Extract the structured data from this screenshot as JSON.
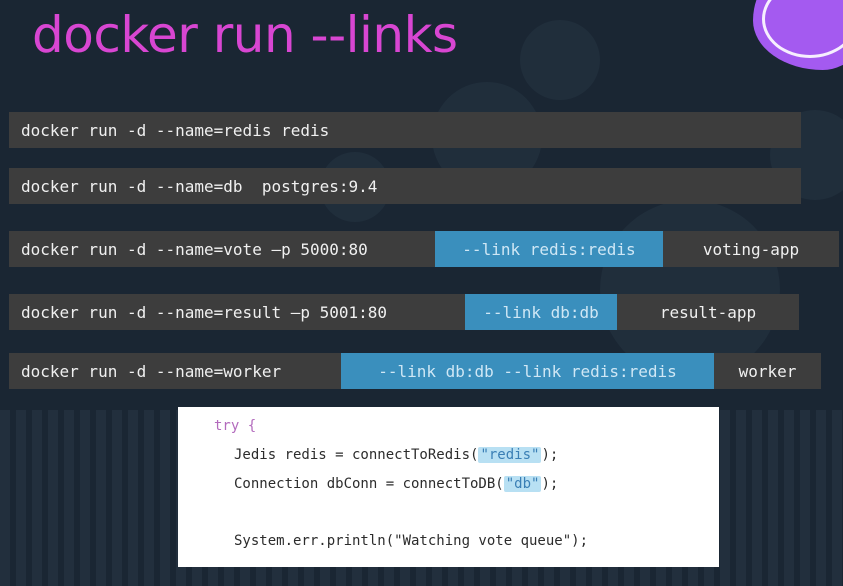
{
  "slide": {
    "title": "docker run --links"
  },
  "commands": [
    {
      "base": "docker run -d --name=redis redis"
    },
    {
      "base": "docker run -d --name=db  postgres:9.4"
    },
    {
      "base": "docker run -d --name=vote –p 5000:80",
      "link": "--link redis:redis",
      "tail": "voting-app"
    },
    {
      "base": "docker run -d --name=result –p 5001:80",
      "link": "--link db:db",
      "tail": "result-app"
    },
    {
      "base": "docker run -d --name=worker",
      "link": "--link db:db --link redis:redis",
      "tail": "worker"
    }
  ],
  "code": {
    "line1_keyword": "try",
    "line1_brace": " {",
    "line2_prefix": "Jedis redis = connectToRedis(",
    "line2_arg": "\"redis\"",
    "line2_suffix": ");",
    "line3_prefix": "Connection dbConn = connectToDB(",
    "line3_arg": "\"db\"",
    "line3_suffix": ");",
    "line5": "System.err.println(\"Watching vote queue\");"
  },
  "colors": {
    "background": "#1a2633",
    "title": "#d846d2",
    "command_bar": "#3d3d3d",
    "link_highlight": "#3a8fbd",
    "code_keyword": "#b36bbd",
    "code_string": "#3a7fb5",
    "code_string_highlight": "#b8e0f3"
  }
}
